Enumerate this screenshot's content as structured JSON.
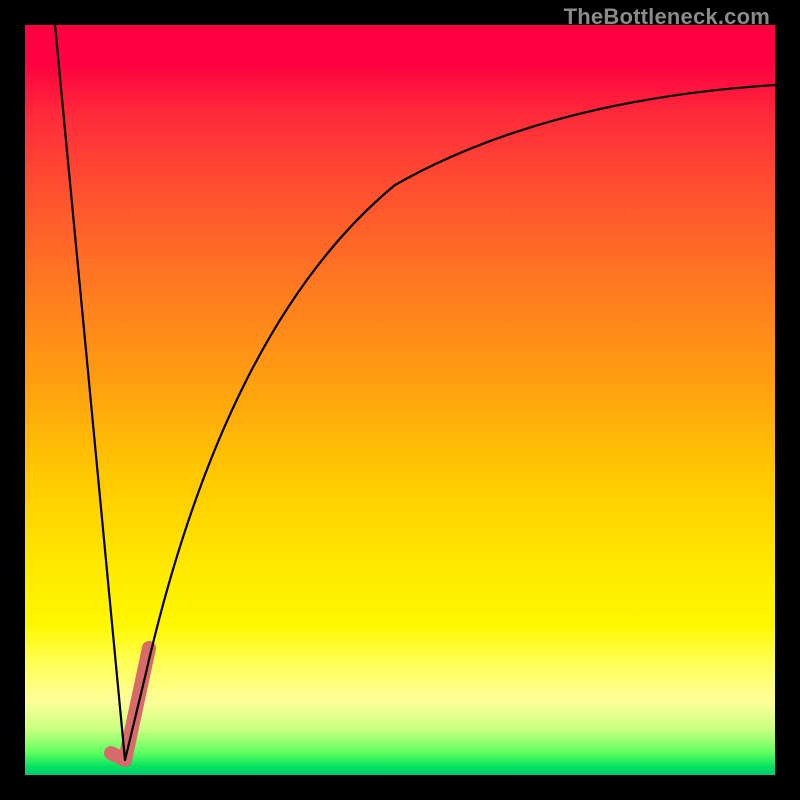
{
  "watermark": {
    "text": "TheBottleneck.com"
  },
  "chart_data": {
    "type": "line",
    "title": "",
    "xlabel": "",
    "ylabel": "",
    "xlim": [
      0,
      1
    ],
    "ylim": [
      0,
      1
    ],
    "grid": false,
    "legend": false,
    "background_gradient": {
      "orientation": "vertical",
      "stops": [
        {
          "pos": 0.0,
          "color": "#ff0040"
        },
        {
          "pos": 0.5,
          "color": "#ffc800"
        },
        {
          "pos": 0.85,
          "color": "#ffff55"
        },
        {
          "pos": 0.97,
          "color": "#60ff60"
        },
        {
          "pos": 1.0,
          "color": "#00c878"
        }
      ]
    },
    "series": [
      {
        "name": "bottleneck_curve",
        "stroke": "#000000",
        "x": [
          0.04,
          0.06,
          0.08,
          0.1,
          0.12,
          0.133,
          0.16,
          0.2,
          0.25,
          0.3,
          0.35,
          0.4,
          0.45,
          0.5,
          0.55,
          0.6,
          0.65,
          0.7,
          0.75,
          0.8,
          0.85,
          0.9,
          0.95,
          1.0
        ],
        "y": [
          1.0,
          0.79,
          0.57,
          0.36,
          0.15,
          0.02,
          0.13,
          0.32,
          0.49,
          0.6,
          0.68,
          0.74,
          0.78,
          0.82,
          0.84,
          0.86,
          0.875,
          0.885,
          0.895,
          0.903,
          0.909,
          0.914,
          0.918,
          0.921
        ]
      },
      {
        "name": "highlight_segment",
        "stroke": "#d86a6a",
        "x": [
          0.115,
          0.133,
          0.165
        ],
        "y": [
          0.03,
          0.02,
          0.17
        ]
      }
    ],
    "notes": "x and y are normalized to the plotting area (0..1). y=0 is the bottom (green) edge; y=1 is the top (red) edge. The black curve forms a sharp V reaching its minimum near x≈0.133, then rises along a saturating curve toward the upper right. The thick muted-red accent traces the bottom of the V."
  }
}
